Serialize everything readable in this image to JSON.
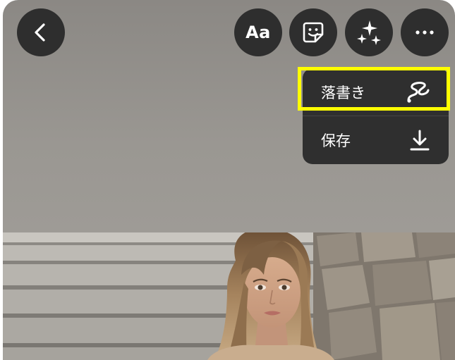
{
  "toolbar": {
    "back_icon": "chevron-left-icon",
    "text_label": "Aa",
    "sticker_icon": "sticker-icon",
    "effects_icon": "sparkles-icon",
    "more_icon": "more-horizontal-icon"
  },
  "menu": {
    "items": [
      {
        "label": "落書き",
        "icon": "scribble-icon"
      },
      {
        "label": "保存",
        "icon": "download-icon"
      }
    ]
  },
  "colors": {
    "highlight": "#ffff00",
    "button_bg": "#2e2e2e",
    "menu_bg": "#2f2f2f"
  }
}
